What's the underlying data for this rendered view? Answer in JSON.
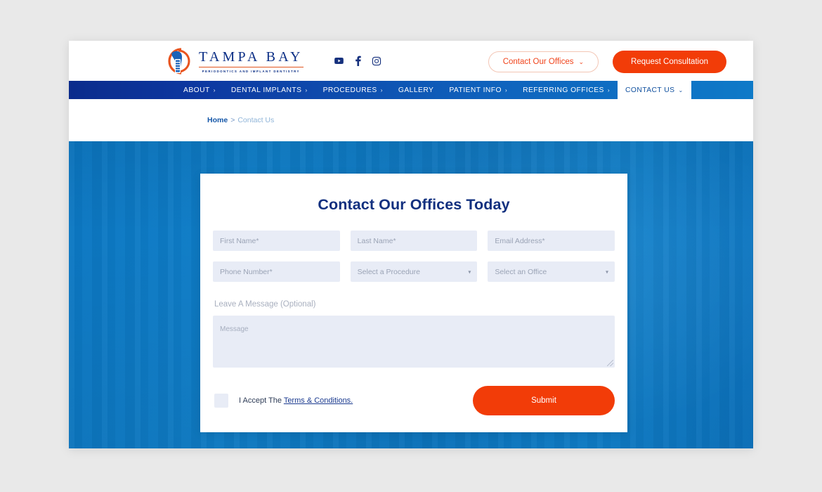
{
  "site": {
    "logo": {
      "wordmark": "TAMPA BAY",
      "tagline": "PERIODONTICS AND IMPLANT DENTISTRY"
    },
    "socials": [
      {
        "name": "youtube-icon",
        "label": "YouTube"
      },
      {
        "name": "facebook-icon",
        "label": "Facebook"
      },
      {
        "name": "instagram-icon",
        "label": "Instagram"
      }
    ],
    "header_actions": {
      "contact_offices_label": "Contact Our Offices",
      "contact_offices_chevron": "⌄",
      "request_consultation_label": "Request Consultation"
    }
  },
  "nav": {
    "items": [
      {
        "label": "ABOUT",
        "arrow": "›",
        "active": false
      },
      {
        "label": "DENTAL IMPLANTS",
        "arrow": "›",
        "active": false
      },
      {
        "label": "PROCEDURES",
        "arrow": "›",
        "active": false
      },
      {
        "label": "GALLERY",
        "arrow": "",
        "active": false
      },
      {
        "label": "PATIENT INFO",
        "arrow": "›",
        "active": false
      },
      {
        "label": "REFERRING OFFICES",
        "arrow": "›",
        "active": false
      },
      {
        "label": "CONTACT US",
        "arrow": "⌄",
        "active": true
      }
    ]
  },
  "breadcrumb": {
    "home": "Home",
    "separator": ">",
    "current": "Contact Us"
  },
  "form": {
    "title": "Contact Our Offices Today",
    "fields": {
      "first_name": {
        "placeholder": "First Name*",
        "value": ""
      },
      "last_name": {
        "placeholder": "Last Name*",
        "value": ""
      },
      "email": {
        "placeholder": "Email Address*",
        "value": ""
      },
      "phone": {
        "placeholder": "Phone Number*",
        "value": ""
      },
      "procedure": {
        "placeholder": "Select a Procedure",
        "value": "",
        "arrow": "▾"
      },
      "office": {
        "placeholder": "Select an Office",
        "value": "",
        "arrow": "▾"
      }
    },
    "message_label": "Leave A Message (Optional)",
    "message_placeholder": "Message",
    "accept_prefix": "I Accept The ",
    "terms_link": "Terms & Conditions.",
    "submit_label": "Submit"
  },
  "colors": {
    "brand_navy": "#12307f",
    "brand_orange": "#f23c08",
    "hero_blue": "#0c76c0",
    "field_bg": "#e8ecf6"
  }
}
